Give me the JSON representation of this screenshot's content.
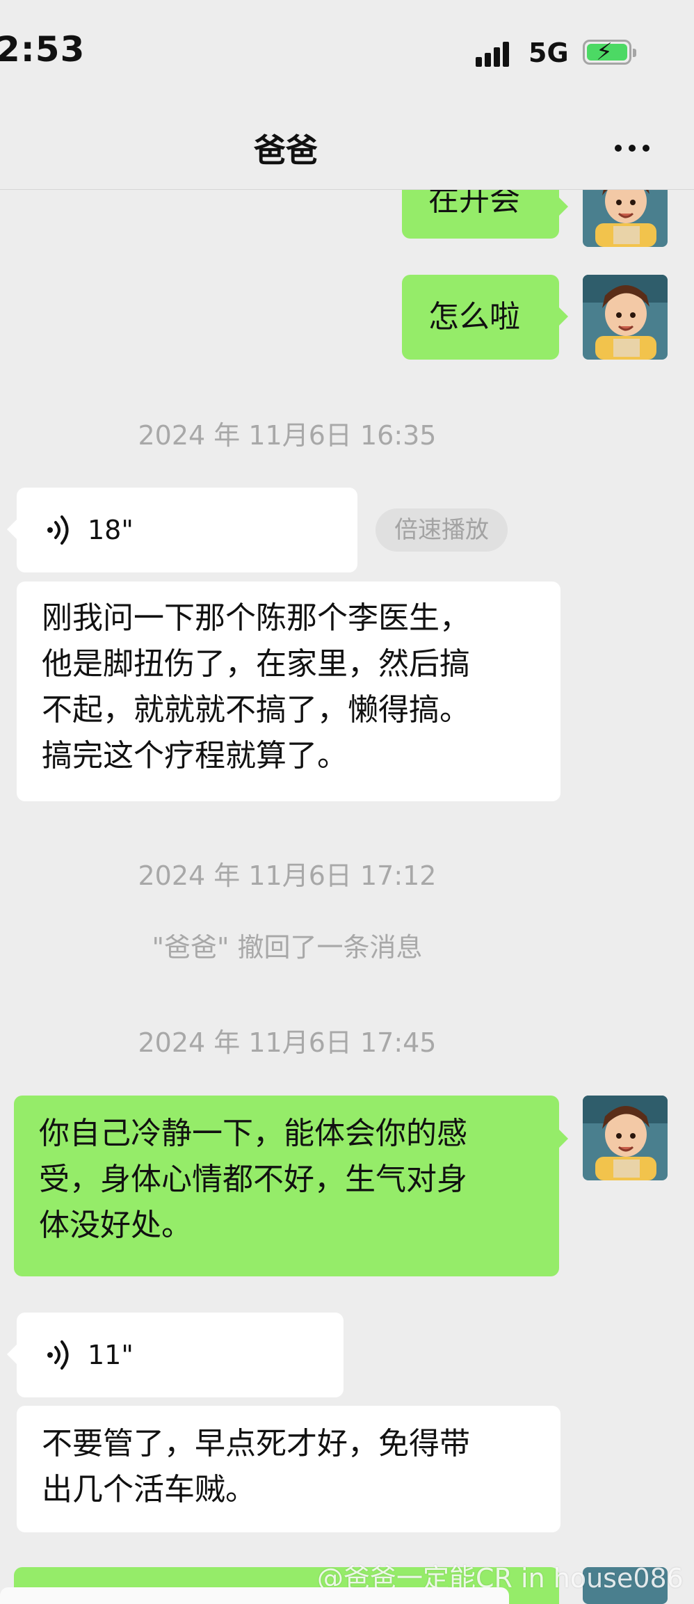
{
  "status_bar": {
    "time": "2:53",
    "network": "5G"
  },
  "header": {
    "title": "爸爸"
  },
  "messages": {
    "m0": "在开会",
    "m1": "怎么啦",
    "ts1": "2024 年 11月6日 16:35",
    "voice1_duration": "18\"",
    "speed_label": "倍速播放",
    "transcript1_lines": [
      "刚我问一下那个陈那个李医生，",
      "他是脚扭伤了，在家里，然后搞",
      "不起，就就就不搞了，懒得搞。",
      "搞完这个疗程就算了。"
    ],
    "ts2": "2024 年 11月6日 17:12",
    "recall_notice": "\"爸爸\" 撤回了一条消息",
    "ts3": "2024 年 11月6日 17:45",
    "m_me2_lines": [
      "你自己冷静一下，能体会你的感",
      "受，身体心情都不好，生气对身",
      "体没好处。"
    ],
    "voice2_duration": "11\"",
    "transcript2_lines": [
      "不要管了，早点死才好，免得带",
      "出几个活车贼。"
    ]
  },
  "watermark": "@爸爸一定能CR in house086",
  "icons": {
    "more": "more-dots-icon",
    "voice": "voice-wave-icon",
    "avatar": "user-avatar"
  },
  "colors": {
    "background": "#ededed",
    "my_bubble": "#95ec69",
    "other_bubble": "#ffffff",
    "timestamp": "#a8a8a8",
    "battery": "#4cd964"
  }
}
